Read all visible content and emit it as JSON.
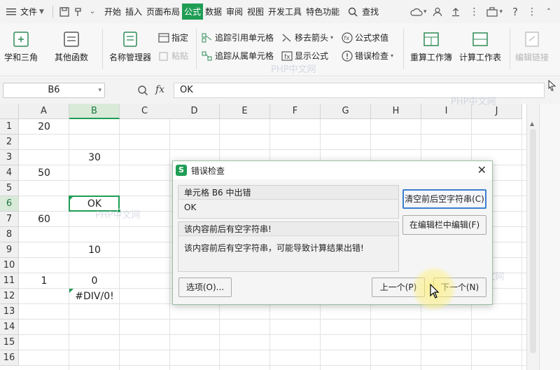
{
  "menubar": {
    "file_label": "文件",
    "tabs": [
      "开始",
      "插入",
      "页面布局",
      "公式",
      "数据",
      "审阅",
      "视图",
      "开发工具",
      "特色功能"
    ],
    "active_tab": "公式",
    "search_label": "查找"
  },
  "ribbon": {
    "math_trig": "学和三角",
    "other_funcs": "其他函数",
    "name_manager": "名称管理器",
    "define": "指定",
    "paste": "粘贴",
    "trace_precedents": "追踪引用单元格",
    "trace_dependents": "追踪从属单元格",
    "remove_arrows": "移去箭头",
    "show_formulas": "显示公式",
    "evaluate_formula": "公式求值",
    "error_check": "错误检查",
    "recalc_workbook": "重算工作簿",
    "calc_sheet": "计算工作表",
    "edit_links": "编辑链接"
  },
  "formula_bar": {
    "name_box": "B6",
    "fx": "fx",
    "value": "OK"
  },
  "columns": [
    "A",
    "B",
    "C",
    "D",
    "E",
    "F",
    "G",
    "H",
    "I",
    "J"
  ],
  "selected_column": "B",
  "rows": [
    "1",
    "2",
    "3",
    "4",
    "5",
    "6",
    "7",
    "8",
    "9",
    "10",
    "11",
    "12",
    "13",
    "14",
    "15",
    "16"
  ],
  "selected_row": "6",
  "cells": {
    "A1": "20",
    "B3": "30",
    "A4": "50",
    "B6": "OK",
    "A7": "60",
    "B9": "10",
    "A11": "1",
    "B11": "0",
    "B12": "#DIV/0!"
  },
  "dialog": {
    "title": "错误检查",
    "cell_error_heading": "单元格 B6 中出错",
    "cell_value": "OK",
    "desc_heading": "该内容前后有空字符串!",
    "desc_body": "该内容前后有空字符串，可能导致计算结果出错!",
    "btn_trim": "清空前后空字符串(C)",
    "btn_edit_in_bar": "在编辑栏中编辑(F)",
    "btn_options": "选项(O)...",
    "btn_prev": "上一个(P)",
    "btn_next": "下一个(N)"
  },
  "watermark": "PHP中文网",
  "colors": {
    "accent_green": "#1f9d55",
    "primary_button_border": "#3b7fd0"
  }
}
